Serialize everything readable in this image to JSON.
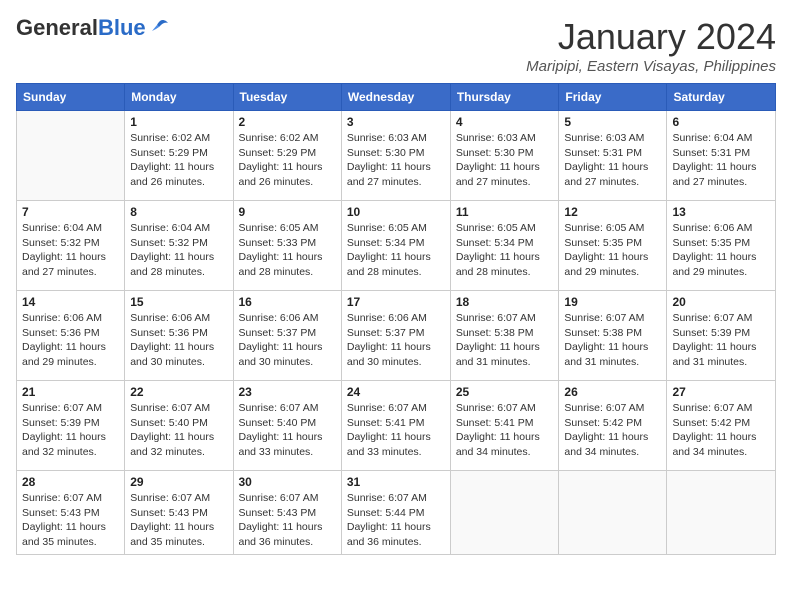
{
  "header": {
    "logo_general": "General",
    "logo_blue": "Blue",
    "main_title": "January 2024",
    "subtitle": "Maripipi, Eastern Visayas, Philippines"
  },
  "calendar": {
    "days_of_week": [
      "Sunday",
      "Monday",
      "Tuesday",
      "Wednesday",
      "Thursday",
      "Friday",
      "Saturday"
    ],
    "weeks": [
      [
        {
          "day": "",
          "info": ""
        },
        {
          "day": "1",
          "info": "Sunrise: 6:02 AM\nSunset: 5:29 PM\nDaylight: 11 hours\nand 26 minutes."
        },
        {
          "day": "2",
          "info": "Sunrise: 6:02 AM\nSunset: 5:29 PM\nDaylight: 11 hours\nand 26 minutes."
        },
        {
          "day": "3",
          "info": "Sunrise: 6:03 AM\nSunset: 5:30 PM\nDaylight: 11 hours\nand 27 minutes."
        },
        {
          "day": "4",
          "info": "Sunrise: 6:03 AM\nSunset: 5:30 PM\nDaylight: 11 hours\nand 27 minutes."
        },
        {
          "day": "5",
          "info": "Sunrise: 6:03 AM\nSunset: 5:31 PM\nDaylight: 11 hours\nand 27 minutes."
        },
        {
          "day": "6",
          "info": "Sunrise: 6:04 AM\nSunset: 5:31 PM\nDaylight: 11 hours\nand 27 minutes."
        }
      ],
      [
        {
          "day": "7",
          "info": "Sunrise: 6:04 AM\nSunset: 5:32 PM\nDaylight: 11 hours\nand 27 minutes."
        },
        {
          "day": "8",
          "info": "Sunrise: 6:04 AM\nSunset: 5:32 PM\nDaylight: 11 hours\nand 28 minutes."
        },
        {
          "day": "9",
          "info": "Sunrise: 6:05 AM\nSunset: 5:33 PM\nDaylight: 11 hours\nand 28 minutes."
        },
        {
          "day": "10",
          "info": "Sunrise: 6:05 AM\nSunset: 5:34 PM\nDaylight: 11 hours\nand 28 minutes."
        },
        {
          "day": "11",
          "info": "Sunrise: 6:05 AM\nSunset: 5:34 PM\nDaylight: 11 hours\nand 28 minutes."
        },
        {
          "day": "12",
          "info": "Sunrise: 6:05 AM\nSunset: 5:35 PM\nDaylight: 11 hours\nand 29 minutes."
        },
        {
          "day": "13",
          "info": "Sunrise: 6:06 AM\nSunset: 5:35 PM\nDaylight: 11 hours\nand 29 minutes."
        }
      ],
      [
        {
          "day": "14",
          "info": "Sunrise: 6:06 AM\nSunset: 5:36 PM\nDaylight: 11 hours\nand 29 minutes."
        },
        {
          "day": "15",
          "info": "Sunrise: 6:06 AM\nSunset: 5:36 PM\nDaylight: 11 hours\nand 30 minutes."
        },
        {
          "day": "16",
          "info": "Sunrise: 6:06 AM\nSunset: 5:37 PM\nDaylight: 11 hours\nand 30 minutes."
        },
        {
          "day": "17",
          "info": "Sunrise: 6:06 AM\nSunset: 5:37 PM\nDaylight: 11 hours\nand 30 minutes."
        },
        {
          "day": "18",
          "info": "Sunrise: 6:07 AM\nSunset: 5:38 PM\nDaylight: 11 hours\nand 31 minutes."
        },
        {
          "day": "19",
          "info": "Sunrise: 6:07 AM\nSunset: 5:38 PM\nDaylight: 11 hours\nand 31 minutes."
        },
        {
          "day": "20",
          "info": "Sunrise: 6:07 AM\nSunset: 5:39 PM\nDaylight: 11 hours\nand 31 minutes."
        }
      ],
      [
        {
          "day": "21",
          "info": "Sunrise: 6:07 AM\nSunset: 5:39 PM\nDaylight: 11 hours\nand 32 minutes."
        },
        {
          "day": "22",
          "info": "Sunrise: 6:07 AM\nSunset: 5:40 PM\nDaylight: 11 hours\nand 32 minutes."
        },
        {
          "day": "23",
          "info": "Sunrise: 6:07 AM\nSunset: 5:40 PM\nDaylight: 11 hours\nand 33 minutes."
        },
        {
          "day": "24",
          "info": "Sunrise: 6:07 AM\nSunset: 5:41 PM\nDaylight: 11 hours\nand 33 minutes."
        },
        {
          "day": "25",
          "info": "Sunrise: 6:07 AM\nSunset: 5:41 PM\nDaylight: 11 hours\nand 34 minutes."
        },
        {
          "day": "26",
          "info": "Sunrise: 6:07 AM\nSunset: 5:42 PM\nDaylight: 11 hours\nand 34 minutes."
        },
        {
          "day": "27",
          "info": "Sunrise: 6:07 AM\nSunset: 5:42 PM\nDaylight: 11 hours\nand 34 minutes."
        }
      ],
      [
        {
          "day": "28",
          "info": "Sunrise: 6:07 AM\nSunset: 5:43 PM\nDaylight: 11 hours\nand 35 minutes."
        },
        {
          "day": "29",
          "info": "Sunrise: 6:07 AM\nSunset: 5:43 PM\nDaylight: 11 hours\nand 35 minutes."
        },
        {
          "day": "30",
          "info": "Sunrise: 6:07 AM\nSunset: 5:43 PM\nDaylight: 11 hours\nand 36 minutes."
        },
        {
          "day": "31",
          "info": "Sunrise: 6:07 AM\nSunset: 5:44 PM\nDaylight: 11 hours\nand 36 minutes."
        },
        {
          "day": "",
          "info": ""
        },
        {
          "day": "",
          "info": ""
        },
        {
          "day": "",
          "info": ""
        }
      ]
    ]
  }
}
